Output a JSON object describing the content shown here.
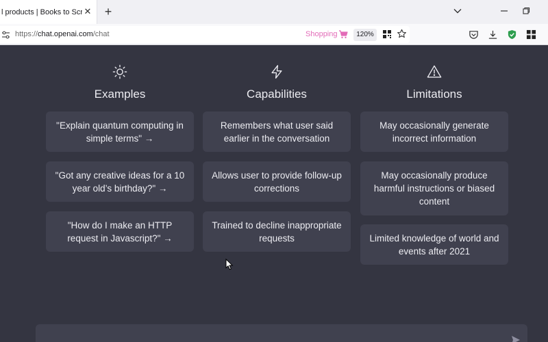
{
  "browser": {
    "tab_title": "l products | Books to Scrape",
    "tab_close": "✕",
    "new_tab": "+",
    "url_prefix": "https://",
    "url_host": "chat.openai.com",
    "url_path": "/chat",
    "shopping_label": "Shopping",
    "zoom": "120%"
  },
  "columns": [
    {
      "title": "Examples",
      "icon": "sun-icon",
      "cards": [
        "\"Explain quantum computing in simple terms\" →",
        "\"Got any creative ideas for a 10 year old’s birthday?\" →",
        "\"How do I make an HTTP request in Javascript?\" →"
      ]
    },
    {
      "title": "Capabilities",
      "icon": "lightning-icon",
      "cards": [
        "Remembers what user said earlier in the conversation",
        "Allows user to provide follow-up corrections",
        "Trained to decline inappropriate requests"
      ]
    },
    {
      "title": "Limitations",
      "icon": "warning-icon",
      "cards": [
        "May occasionally generate incorrect information",
        "May occasionally produce harmful instructions or biased content",
        "Limited knowledge of world and events after 2021"
      ]
    }
  ],
  "colors": {
    "page_bg": "#343541",
    "card_bg": "#40414f",
    "text": "#ececf1",
    "shopping": "#e36bb8",
    "shield_green": "#2e9e4f"
  }
}
